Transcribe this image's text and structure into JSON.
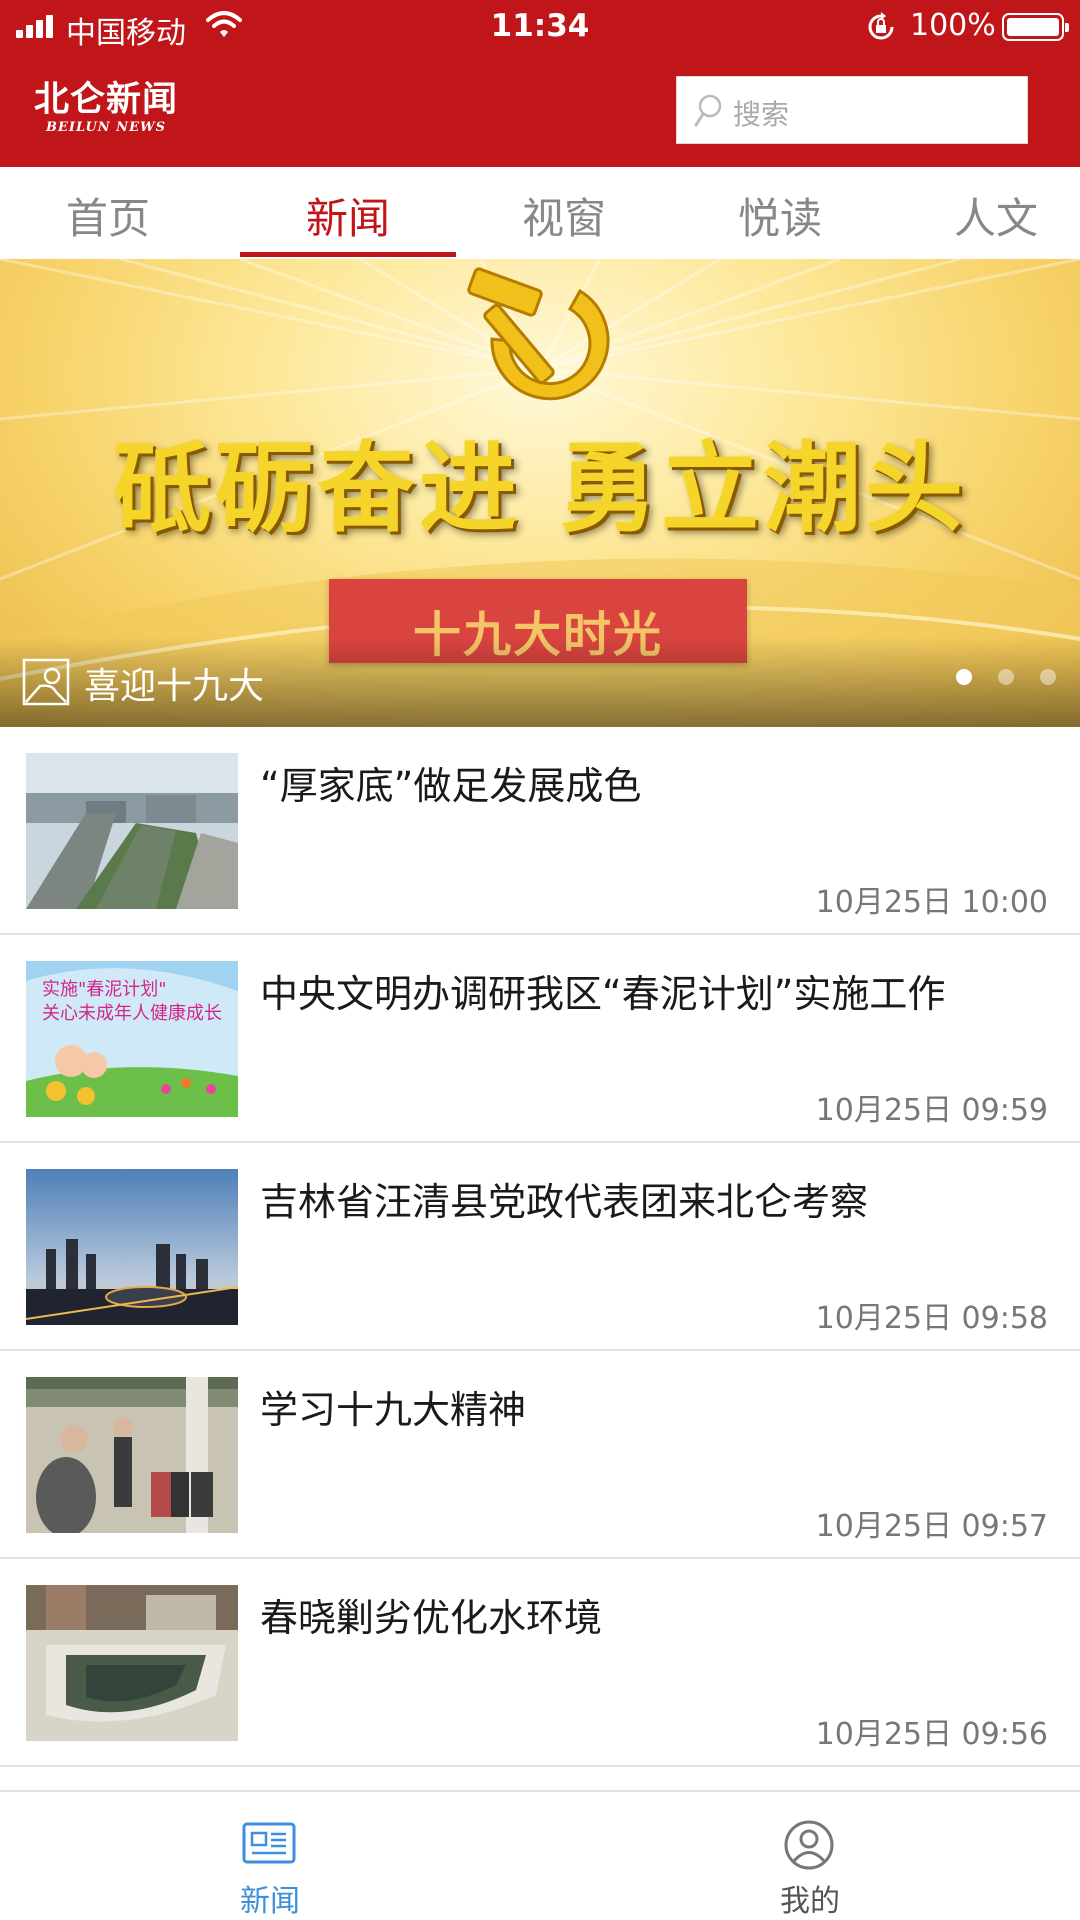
{
  "status_bar": {
    "carrier": "中国移动",
    "time": "11:34",
    "battery": "100%"
  },
  "header": {
    "logo_cn": "北仑新闻",
    "logo_en": "BEILUN NEWS",
    "search_placeholder": "搜索"
  },
  "tabs": [
    {
      "label": "首页",
      "active": false
    },
    {
      "label": "新闻",
      "active": true
    },
    {
      "label": "视窗",
      "active": false
    },
    {
      "label": "悦读",
      "active": false
    },
    {
      "label": "人文",
      "active": false
    }
  ],
  "banner": {
    "slogan": "砥砺奋进 勇立潮头",
    "plate": "十九大时光",
    "caption": "喜迎十九大",
    "slide_count": 3,
    "active_slide": 1
  },
  "news": [
    {
      "title": "“厚家底”做足发展成色",
      "time": "10月25日 10:00"
    },
    {
      "title": "中央文明办调研我区“春泥计划”实施工作",
      "time": "10月25日 09:59"
    },
    {
      "title": "吉林省汪清县党政代表团来北仑考察",
      "time": "10月25日 09:58"
    },
    {
      "title": "学习十九大精神",
      "time": "10月25日 09:57"
    },
    {
      "title": "春晓剿劣优化水环境",
      "time": "10月25日 09:56"
    }
  ],
  "bottom_nav": [
    {
      "label": "新闻",
      "icon": "newspaper-icon",
      "active": true
    },
    {
      "label": "我的",
      "icon": "user-icon",
      "active": false
    }
  ],
  "colors": {
    "brand_red": "#c0161a",
    "nav_active_blue": "#3d8fdc",
    "banner_gold": "#f6d52a"
  }
}
